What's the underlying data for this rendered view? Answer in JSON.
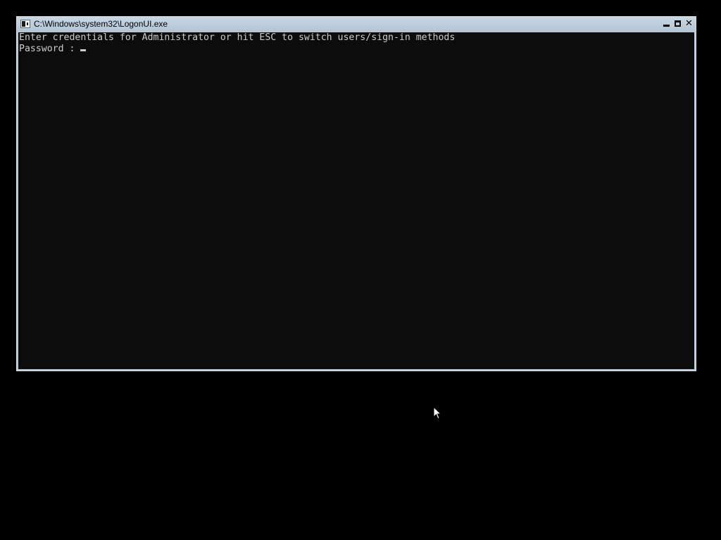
{
  "window": {
    "title": "C:\\Windows\\system32\\LogonUI.exe",
    "close_glyph": "✕"
  },
  "console": {
    "prompt_line": "Enter credentials for Administrator or hit ESC to switch users/sign-in methods",
    "password_label": "Password :",
    "password_value": ""
  },
  "colors": {
    "desktop_background": "#000000",
    "console_background": "#0c0c0c",
    "console_text": "#cccccc",
    "window_frame": "#b9c9d8"
  },
  "icons": {
    "app": "console-app-icon",
    "minimize": "minimize-icon",
    "maximize": "maximize-icon",
    "close": "close-icon",
    "pointer": "mouse-pointer-icon"
  }
}
